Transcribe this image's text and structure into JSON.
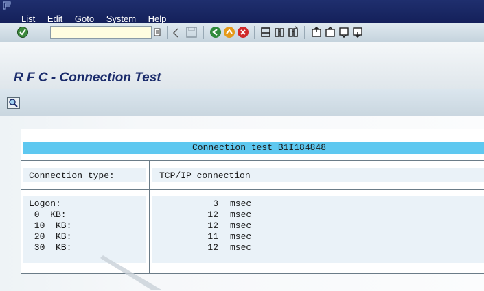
{
  "menu": [
    "List",
    "Edit",
    "Goto",
    "System",
    "Help"
  ],
  "toolbar": {
    "command_field_value": "",
    "icons": [
      "enter-icon",
      "command-history-icon",
      "back-arrow-icon",
      "save-icon",
      "back-icon",
      "exit-icon",
      "cancel-icon",
      "print-icon",
      "find-icon",
      "find-next-icon",
      "first-page-icon",
      "previous-page-icon",
      "next-page-icon",
      "last-page-icon"
    ]
  },
  "page": {
    "title": "R F C - Connection Test"
  },
  "app_toolbar": {
    "icons": [
      "display-details-icon"
    ]
  },
  "result": {
    "header": "Connection test B1I184848",
    "connection_type_label": "Connection type:",
    "connection_type_value": "TCP/IP connection",
    "rows": [
      {
        "label": "Logon:",
        "value": "3",
        "unit": "msec"
      },
      {
        "label": " 0  KB:",
        "value": "12",
        "unit": "msec"
      },
      {
        "label": " 10  KB:",
        "value": "12",
        "unit": "msec"
      },
      {
        "label": " 20  KB:",
        "value": "11",
        "unit": "msec"
      },
      {
        "label": " 30  KB:",
        "value": "12",
        "unit": "msec"
      }
    ]
  },
  "colors": {
    "menubar": "#1f2f6e",
    "header_bar": "#5ec8f0",
    "title": "#1a2b6b"
  }
}
